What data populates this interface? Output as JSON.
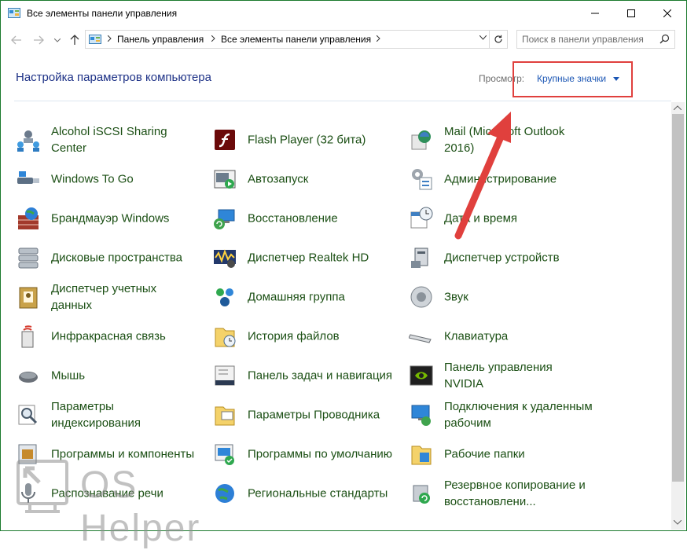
{
  "window": {
    "title": "Все элементы панели управления",
    "minimize_icon": "minimize-icon",
    "maximize_icon": "maximize-icon",
    "close_icon": "close-icon"
  },
  "address": {
    "crumbs": [
      "Панель управления",
      "Все элементы панели управления"
    ],
    "search_placeholder": "Поиск в панели управления"
  },
  "header": {
    "title": "Настройка параметров компьютера",
    "view_label": "Просмотр:",
    "view_value": "Крупные значки"
  },
  "colors": {
    "accent": "#1a55b4",
    "item_text": "#1b4f14",
    "heading": "#1e3287",
    "annotation": "#e0403d"
  },
  "items": [
    {
      "label": "Alcohol iSCSI Sharing Center",
      "icon": "network-users-icon"
    },
    {
      "label": "Flash Player (32 бита)",
      "icon": "flash-player-icon"
    },
    {
      "label": "Mail (Microsoft Outlook 2016)",
      "icon": "mail-icon"
    },
    {
      "label": "Windows To Go",
      "icon": "usb-drive-icon"
    },
    {
      "label": "Автозапуск",
      "icon": "autoplay-icon"
    },
    {
      "label": "Администрирование",
      "icon": "admin-tools-icon"
    },
    {
      "label": "Брандмауэр Windows",
      "icon": "firewall-icon"
    },
    {
      "label": "Восстановление",
      "icon": "recovery-icon"
    },
    {
      "label": "Дата и время",
      "icon": "calendar-clock-icon"
    },
    {
      "label": "Дисковые пространства",
      "icon": "storage-spaces-icon"
    },
    {
      "label": "Диспетчер Realtek HD",
      "icon": "realtek-audio-icon"
    },
    {
      "label": "Диспетчер устройств",
      "icon": "device-manager-icon"
    },
    {
      "label": "Диспетчер учетных данных",
      "icon": "credential-manager-icon"
    },
    {
      "label": "Домашняя группа",
      "icon": "homegroup-icon"
    },
    {
      "label": "Звук",
      "icon": "speaker-icon"
    },
    {
      "label": "Инфракрасная связь",
      "icon": "infrared-icon"
    },
    {
      "label": "История файлов",
      "icon": "file-history-icon"
    },
    {
      "label": "Клавиатура",
      "icon": "keyboard-icon"
    },
    {
      "label": "Мышь",
      "icon": "mouse-icon"
    },
    {
      "label": "Панель задач и навигация",
      "icon": "taskbar-icon"
    },
    {
      "label": "Панель управления NVIDIA",
      "icon": "nvidia-icon"
    },
    {
      "label": "Параметры индексирования",
      "icon": "indexing-icon"
    },
    {
      "label": "Параметры Проводника",
      "icon": "folder-options-icon"
    },
    {
      "label": "Подключения к удаленным рабочим",
      "icon": "remote-desktop-icon"
    },
    {
      "label": "Программы и компоненты",
      "icon": "programs-icon"
    },
    {
      "label": "Программы по умолчанию",
      "icon": "default-programs-icon"
    },
    {
      "label": "Рабочие папки",
      "icon": "work-folders-icon"
    },
    {
      "label": "Распознавание речи",
      "icon": "microphone-icon"
    },
    {
      "label": "Региональные стандарты",
      "icon": "region-icon"
    },
    {
      "label": "Резервное копирование и восстановлени...",
      "icon": "backup-icon"
    }
  ],
  "watermark": {
    "text": "OS Helper"
  }
}
